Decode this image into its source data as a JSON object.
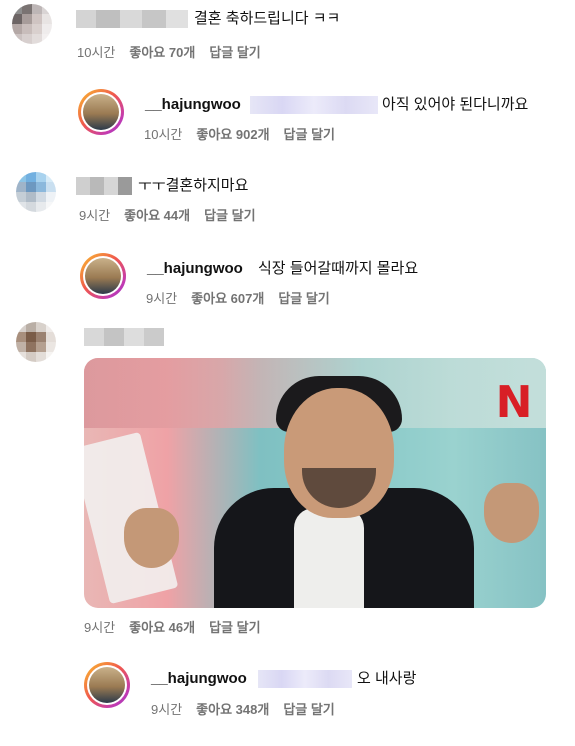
{
  "comments": [
    {
      "text": "결혼 축하드립니다 ㅋㅋ",
      "time": "10시간",
      "likes": "좋아요 70개",
      "reply": "답글 달기",
      "reply_item": {
        "username": "__hajungwoo",
        "text": "아직 있어야 된다니까요",
        "time": "10시간",
        "likes": "좋아요 902개",
        "reply": "답글 달기"
      }
    },
    {
      "text": "ㅜㅜ결혼하지마요",
      "time": "9시간",
      "likes": "좋아요 44개",
      "reply": "답글 달기",
      "reply_item": {
        "username": "__hajungwoo",
        "text": "식장 들어갈때까지 몰라요",
        "time": "9시간",
        "likes": "좋아요 607개",
        "reply": "답글 달기"
      }
    },
    {
      "text": "",
      "gif_logo": "N",
      "time": "9시간",
      "likes": "좋아요 46개",
      "reply": "답글 달기",
      "reply_item": {
        "username": "__hajungwoo",
        "text": "오 내사랑",
        "time": "9시간",
        "likes": "좋아요 348개",
        "reply": "답글 달기"
      }
    }
  ],
  "colors": {
    "meta_text": "#737373",
    "story_ring_start": "#f9c02d",
    "story_ring_end": "#8a3ab9",
    "netflix_red": "#d81f26"
  }
}
